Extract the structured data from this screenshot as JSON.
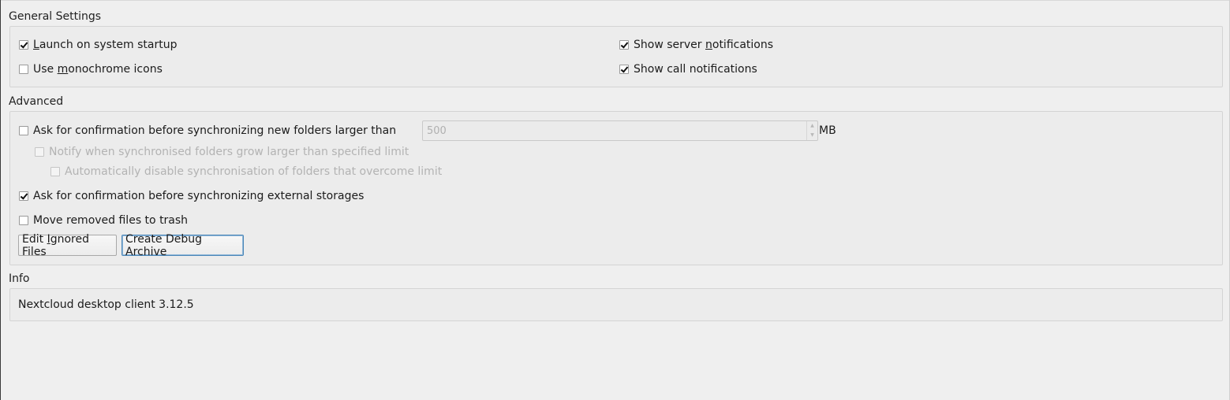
{
  "general": {
    "title": "General Settings",
    "launch_on_startup": {
      "label": "Launch on system startup",
      "checked": true
    },
    "monochrome_icons": {
      "label": "Use monochrome icons",
      "checked": false
    },
    "server_notifications": {
      "label": "Show server notifications",
      "checked": true
    },
    "call_notifications": {
      "label": "Show call notifications",
      "checked": true
    }
  },
  "advanced": {
    "title": "Advanced",
    "ask_large_folders": {
      "label": "Ask for confirmation before synchronizing new folders larger than",
      "checked": false
    },
    "size_limit": {
      "value": "500",
      "unit": "MB"
    },
    "notify_grow": {
      "label": "Notify when synchronised folders grow larger than specified limit",
      "checked": false,
      "disabled": true
    },
    "auto_disable": {
      "label": "Automatically disable synchronisation of folders that overcome limit",
      "checked": false,
      "disabled": true
    },
    "ask_external": {
      "label": "Ask for confirmation before synchronizing external storages",
      "checked": true
    },
    "move_to_trash": {
      "label": "Move removed files to trash",
      "checked": false
    },
    "edit_ignored_button": "Edit Ignored Files",
    "debug_archive_button": "Create Debug Archive"
  },
  "info": {
    "title": "Info",
    "version_text": "Nextcloud desktop client 3.12.5"
  }
}
